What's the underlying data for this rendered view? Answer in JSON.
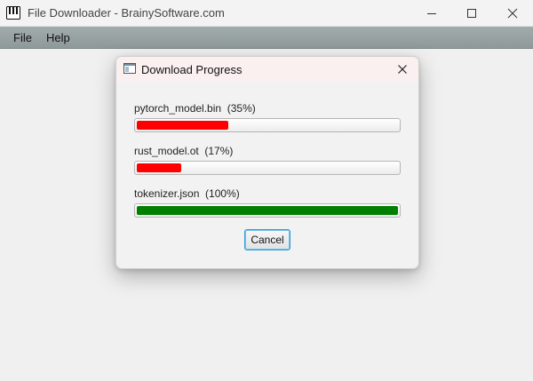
{
  "window": {
    "title": "File Downloader - BrainySoftware.com",
    "controls": {
      "minimize_icon": "minimize-icon",
      "maximize_icon": "maximize-icon",
      "close_icon": "close-icon"
    }
  },
  "menubar": {
    "items": [
      {
        "label": "File"
      },
      {
        "label": "Help"
      }
    ]
  },
  "dialog": {
    "title": "Download Progress",
    "icon": "window-icon",
    "close_icon": "close-icon",
    "downloads": [
      {
        "label": "pytorch_model.bin  (35%)",
        "file": "pytorch_model.bin",
        "percent": 35,
        "bar_color": "#ff0000"
      },
      {
        "label": "rust_model.ot  (17%)",
        "file": "rust_model.ot",
        "percent": 17,
        "bar_color": "#ff0000"
      },
      {
        "label": "tokenizer.json  (100%)",
        "file": "tokenizer.json",
        "percent": 100,
        "bar_color": "#008000"
      }
    ],
    "cancel_label": "Cancel"
  },
  "colors": {
    "accent": "#2f9bd7",
    "in_progress": "#ff0000",
    "complete": "#008000"
  }
}
